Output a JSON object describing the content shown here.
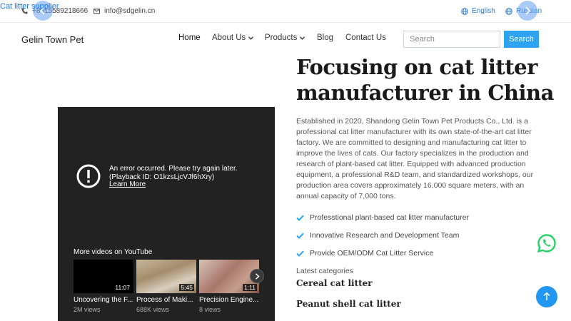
{
  "topbar": {
    "phone": "+8615589218666",
    "email": "info@sdgelin.cn",
    "languages": [
      "English",
      "Russian"
    ]
  },
  "overlay": {
    "link_text": "Cat litter supplier"
  },
  "header": {
    "brand": "Gelin Town Pet",
    "nav": [
      "Home",
      "About Us",
      "Products",
      "Blog",
      "Contact Us"
    ],
    "search_placeholder": "Search",
    "search_button": "Search"
  },
  "video": {
    "error_message": "An error occurred. Please try again later. (Playback ID: O1kzsLjcVJf6hXry)",
    "learn_more": "Learn More",
    "more_videos_label": "More videos on YouTube",
    "thumbnails": [
      {
        "title": "Uncovering the F...",
        "views": "2M views",
        "duration": "11:07"
      },
      {
        "title": "Process of Maki...",
        "views": "688K views",
        "duration": "5:45"
      },
      {
        "title": "Precision Engine...",
        "views": "8 views",
        "duration": "1:11"
      }
    ]
  },
  "hero": {
    "title": "Focusing on cat litter manufacturer in China",
    "intro": "Established in 2020, Shandong Gelin Town Pet Products Co., Ltd. is a professional cat litter manufacturer with its own state-of-the-art cat litter factory. We are committed to designing and manufacturing cat litter to improve the lives of cats. Our factory specializes in the production and research of plant-based cat litter. Equipped with advanced production equipment, a professional R&D team, and standardized workshops, our production area covers approximately 16,000 square meters, with an annual capacity of 7,000 tons.",
    "features": [
      "Professtional plant-based cat litter manufacturer",
      "Innovative Research and Development Team",
      "Provide OEM/ODM Cat Litter Service"
    ],
    "latest_label": "Latest categories",
    "categories": [
      "Cereal cat litter",
      "Peanut shell cat litter"
    ]
  },
  "colors": {
    "accent": "#2ea3f2",
    "check": "#2ea3f2",
    "whatsapp": "#25d366",
    "video_bg": "#222222"
  },
  "icons": [
    "phone-icon",
    "mail-icon",
    "globe-icon",
    "chevron-down-icon",
    "check-icon",
    "error-icon",
    "chevron-right-icon",
    "whatsapp-icon",
    "arrow-up-icon"
  ]
}
